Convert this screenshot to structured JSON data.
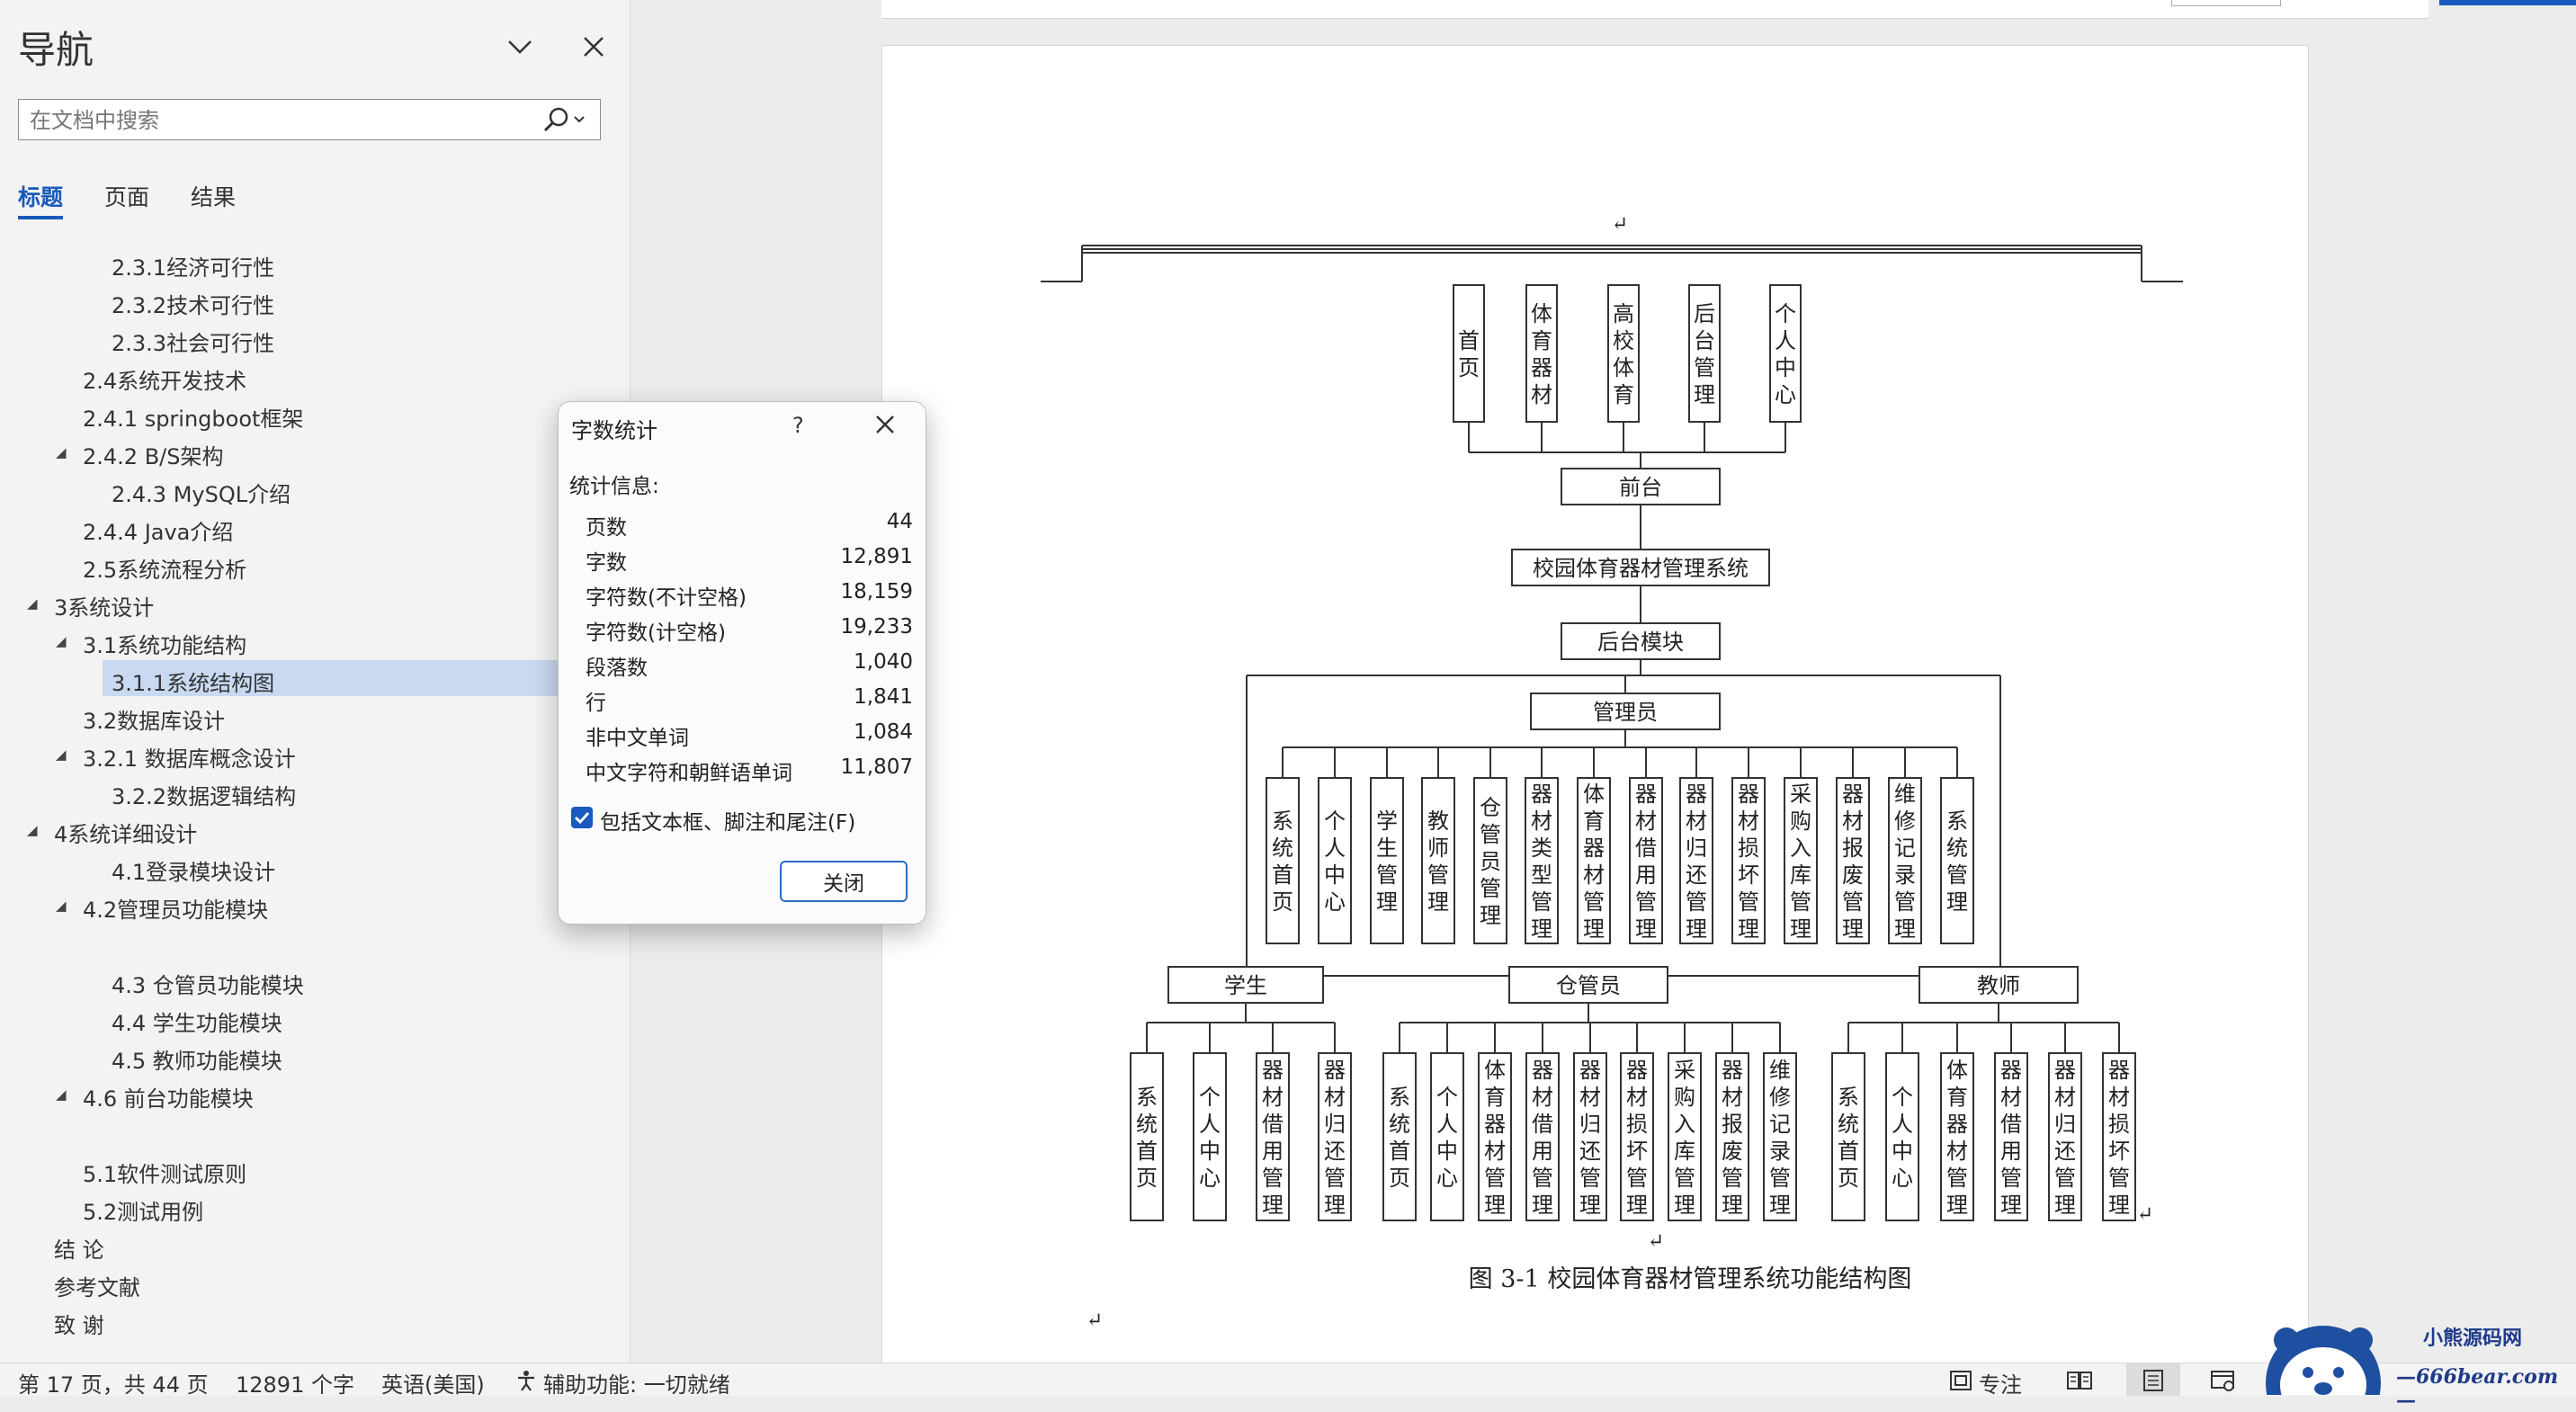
{
  "nav": {
    "title": "导航",
    "search_placeholder": "在文档中搜索",
    "tabs": [
      "标题",
      "页面",
      "结果"
    ],
    "headings": [
      {
        "text": "2.3.1经济可行性",
        "level": 3,
        "toggle": false
      },
      {
        "text": "2.3.2技术可行性",
        "level": 3,
        "toggle": false
      },
      {
        "text": "2.3.3社会可行性",
        "level": 3,
        "toggle": false
      },
      {
        "text": "2.4系统开发技术",
        "level": 2,
        "toggle": false
      },
      {
        "text": "2.4.1 springboot框架",
        "level": 2,
        "toggle": false
      },
      {
        "text": "2.4.2 B/S架构",
        "level": 2,
        "toggle": true
      },
      {
        "text": "2.4.3 MySQL介绍",
        "level": 3,
        "toggle": false
      },
      {
        "text": "2.4.4 Java介绍",
        "level": 2,
        "toggle": false
      },
      {
        "text": "2.5系统流程分析",
        "level": 2,
        "toggle": false
      },
      {
        "text": "3系统设计",
        "level": 1,
        "toggle": true
      },
      {
        "text": "3.1系统功能结构",
        "level": 2,
        "toggle": true
      },
      {
        "text": "3.1.1系统结构图",
        "level": 3,
        "toggle": false,
        "selected": true
      },
      {
        "text": "3.2数据库设计",
        "level": 2,
        "toggle": false
      },
      {
        "text": "3.2.1 数据库概念设计",
        "level": 2,
        "toggle": true
      },
      {
        "text": "3.2.2数据逻辑结构",
        "level": 3,
        "toggle": false
      },
      {
        "text": "4系统详细设计",
        "level": 1,
        "toggle": true
      },
      {
        "text": "4.1登录模块设计",
        "level": 3,
        "toggle": false
      },
      {
        "text": "4.2管理员功能模块",
        "level": 2,
        "toggle": true
      },
      {
        "text": "",
        "level": 3,
        "toggle": false
      },
      {
        "text": "4.3 仓管员功能模块",
        "level": 3,
        "toggle": false
      },
      {
        "text": "4.4 学生功能模块",
        "level": 3,
        "toggle": false
      },
      {
        "text": "4.5 教师功能模块",
        "level": 3,
        "toggle": false
      },
      {
        "text": "4.6 前台功能模块",
        "level": 2,
        "toggle": true
      },
      {
        "text": "",
        "level": 2,
        "toggle": false
      },
      {
        "text": "5.1软件测试原则",
        "level": 2,
        "toggle": false
      },
      {
        "text": "5.2测试用例",
        "level": 2,
        "toggle": false
      },
      {
        "text": "结 论",
        "level": 1,
        "toggle": false
      },
      {
        "text": "参考文献",
        "level": 1,
        "toggle": false
      },
      {
        "text": "致 谢",
        "level": 1,
        "toggle": false
      }
    ]
  },
  "dialog": {
    "title": "字数统计",
    "help": "?",
    "section": "统计信息:",
    "rows": [
      {
        "label": "页数",
        "value": "44"
      },
      {
        "label": "字数",
        "value": "12,891"
      },
      {
        "label": "字符数(不计空格)",
        "value": "18,159"
      },
      {
        "label": "字符数(计空格)",
        "value": "19,233"
      },
      {
        "label": "段落数",
        "value": "1,040"
      },
      {
        "label": "行",
        "value": "1,841"
      },
      {
        "label": "非中文单词",
        "value": "1,084"
      },
      {
        "label": "中文字符和朝鲜语单词",
        "value": "11,807"
      }
    ],
    "checkbox_label": "包括文本框、脚注和尾注(F)",
    "checkbox_checked": true,
    "close_label": "关闭"
  },
  "diagram": {
    "front_children": [
      "首页",
      "体育器材",
      "高校体育",
      "后台管理",
      "个人中心"
    ],
    "front": "前台",
    "system": "校园体育器材管理系统",
    "backend": "后台模块",
    "admin": "管理员",
    "admin_children": [
      "系统首页",
      "个人中心",
      "学生管理",
      "教师管理",
      "仓管员管理",
      "器材类型管理",
      "体育器材管理",
      "器材借用管理",
      "器材归还管理",
      "器材损坏管理",
      "采购入库管理",
      "器材报废管理",
      "维修记录管理",
      "系统管理"
    ],
    "student": "学生",
    "student_children": [
      "系统首页",
      "个人中心",
      "器材借用管理",
      "器材归还管理"
    ],
    "keeper": "仓管员",
    "keeper_children": [
      "系统首页",
      "个人中心",
      "体育器材管理",
      "器材借用管理",
      "器材归还管理",
      "器材损坏管理",
      "采购入库管理",
      "器材报废管理",
      "维修记录管理"
    ],
    "teacher": "教师",
    "teacher_children": [
      "系统首页",
      "个人中心",
      "体育器材管理",
      "器材借用管理",
      "器材归还管理",
      "器材损坏管理"
    ],
    "caption": "图 3-1  校园体育器材管理系统功能结构图",
    "return_mark": "↵"
  },
  "status": {
    "page": "第 17 页，共 44 页",
    "words": "12891 个字",
    "language": "英语(美国)",
    "accessibility": "辅助功能: 一切就绪",
    "focus": "专注"
  },
  "watermark": {
    "line1": "小熊源码网",
    "line2": "—666bear.com—"
  },
  "colors": {
    "accent": "#185abd",
    "selection": "#c9d9f2"
  }
}
